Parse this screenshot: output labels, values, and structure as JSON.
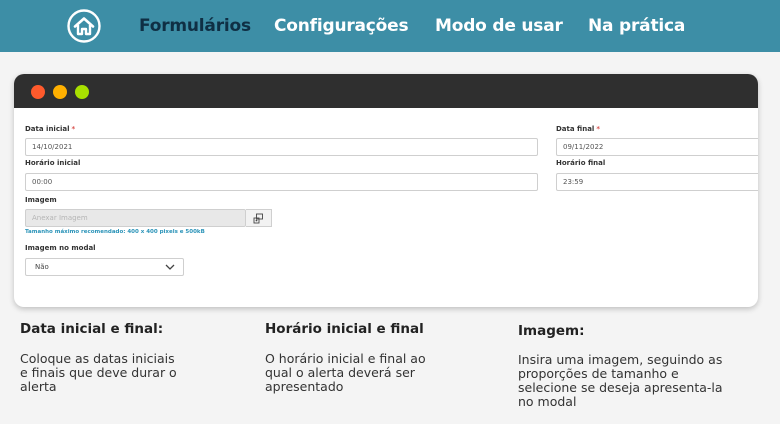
{
  "nav": {
    "items": [
      {
        "label": "Formulários",
        "active": true
      },
      {
        "label": "Configurações",
        "active": false
      },
      {
        "label": "Modo de usar",
        "active": false
      },
      {
        "label": "Na prática",
        "active": false
      }
    ]
  },
  "window": {
    "dots": [
      "#ff5a2c",
      "#ffb000",
      "#a8e000"
    ]
  },
  "form": {
    "data_inicial": {
      "label": "Data inicial",
      "required_mark": "*",
      "value": "14/10/2021"
    },
    "data_final": {
      "label": "Data final",
      "required_mark": "*",
      "value": "09/11/2022"
    },
    "horario_inicial": {
      "label": "Horário inicial",
      "value": "00:00"
    },
    "horario_final": {
      "label": "Horário final",
      "value": "23:59"
    },
    "imagem": {
      "label": "Imagem",
      "placeholder": "Anexar Imagem",
      "hint": "Tamanho máximo recomendado: 400 x 400 pixels e 500kB"
    },
    "imagem_modal": {
      "label": "Imagem no modal",
      "selected": "Não"
    }
  },
  "explanations": [
    {
      "title": "Data inicial e final:",
      "text": "Coloque as datas iniciais\ne finais que deve durar o\nalerta"
    },
    {
      "title": "Horário inicial e final",
      "text": "O horário inicial e final ao\nqual o alerta deverá ser\napresentado"
    },
    {
      "title": "Imagem:",
      "text": "Insira uma imagem, seguindo as\nproporções de tamanho e\nselecione se deseja apresenta-la\nno modal"
    }
  ],
  "colors": {
    "topbar": "#3d8ea6",
    "active_nav": "#0f2f44",
    "hint": "#2a93b8"
  }
}
